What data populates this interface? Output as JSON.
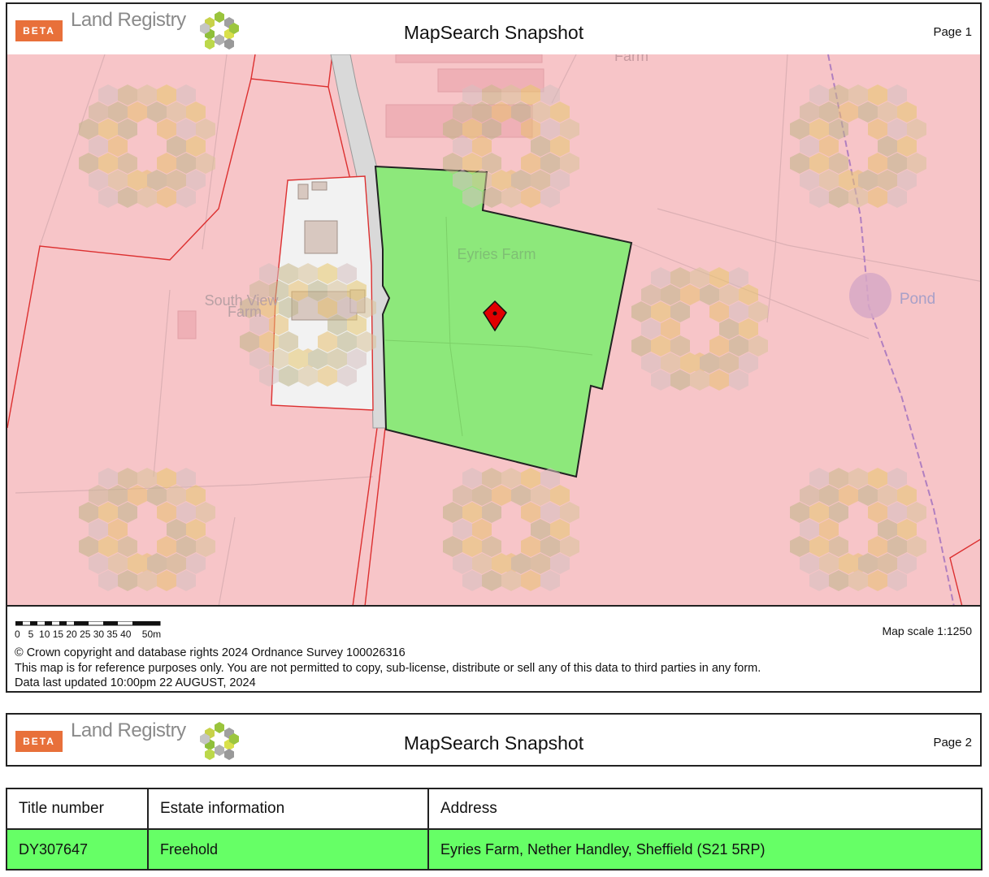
{
  "pages": [
    {
      "beta_label": "BETA",
      "brand": "Land Registry",
      "title": "MapSearch Snapshot",
      "page_label": "Page 1"
    },
    {
      "beta_label": "BETA",
      "brand": "Land Registry",
      "title": "MapSearch Snapshot",
      "page_label": "Page 2"
    }
  ],
  "map": {
    "labels": {
      "top_farm": "Farm",
      "eyries_farm": "Eyries Farm",
      "south_view_line1": "South View",
      "south_view_line2": "Farm",
      "pond": "Pond"
    },
    "colors": {
      "background": "#f7c5c8",
      "parcel_fill": "#8de87b",
      "boundary_line": "#dc3030",
      "marker": "#e00000"
    }
  },
  "footer": {
    "scale_numbers": "0   5  10 15 20 25 30 35 40    50m",
    "map_scale": "Map scale 1:1250",
    "copyright": "© Crown copyright and database rights 2024 Ordnance Survey 100026316",
    "disclaimer": "This map is for reference purposes only. You are not permitted to copy, sub-license, distribute or sell any of this data to third parties in any form.",
    "updated": "Data last updated 10:00pm 22 AUGUST, 2024"
  },
  "table": {
    "headers": [
      "Title number",
      "Estate information",
      "Address"
    ],
    "rows": [
      [
        "DY307647",
        "Freehold",
        "Eyries Farm, Nether Handley, Sheffield (S21 5RP)"
      ]
    ]
  }
}
